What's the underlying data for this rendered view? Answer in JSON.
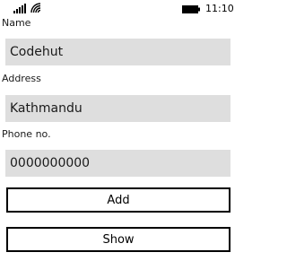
{
  "status_bar": {
    "time": "11:10",
    "icons": [
      "signal-icon",
      "wifi-icon",
      "battery-icon"
    ]
  },
  "form": {
    "name": {
      "label": "Name",
      "value": "Codehut"
    },
    "address": {
      "label": "Address",
      "value": "Kathmandu"
    },
    "phone": {
      "label": "Phone no.",
      "value": "0000000000"
    }
  },
  "buttons": {
    "add_label": "Add",
    "show_label": "Show"
  },
  "colors": {
    "field_background": "#dedede",
    "button_border": "#000000",
    "page_background": "#ffffff"
  }
}
